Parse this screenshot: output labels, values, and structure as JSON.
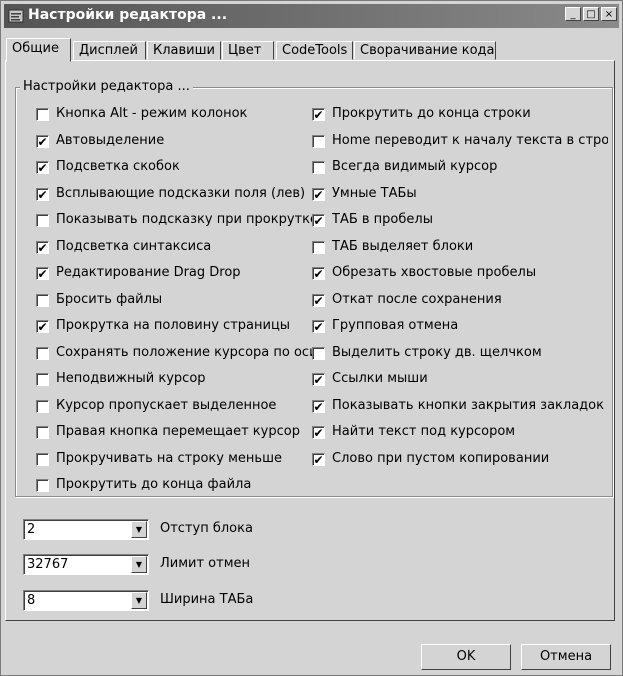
{
  "window": {
    "title": "Настройки редактора ...",
    "minimize": "_",
    "maximize": "□",
    "close": "×"
  },
  "tabs": [
    {
      "label": "Общие",
      "active": true
    },
    {
      "label": "Дисплей",
      "active": false
    },
    {
      "label": "Клавиши",
      "active": false
    },
    {
      "label": "Цвет",
      "active": false
    },
    {
      "label": "CodeTools",
      "active": false
    },
    {
      "label": "Сворачивание кода",
      "active": false
    }
  ],
  "group": {
    "title": "Настройки редактора ..."
  },
  "left_options": [
    {
      "label": "Кнопка Alt - режим колонок",
      "checked": false
    },
    {
      "label": "Автовыделение",
      "checked": true
    },
    {
      "label": "Подсветка скобок",
      "checked": true
    },
    {
      "label": "Всплывающие подсказки поля (лев)",
      "checked": true
    },
    {
      "label": "Показывать подсказку при прокрутке",
      "checked": false
    },
    {
      "label": "Подсветка синтаксиса",
      "checked": true
    },
    {
      "label": "Редактирование Drag Drop",
      "checked": true
    },
    {
      "label": "Бросить файлы",
      "checked": false
    },
    {
      "label": "Прокрутка на половину страницы",
      "checked": true
    },
    {
      "label": "Сохранять положение курсора по оси X",
      "checked": false
    },
    {
      "label": "Неподвижный курсор",
      "checked": false
    },
    {
      "label": "Курсор пропускает выделенное",
      "checked": false
    },
    {
      "label": "Правая кнопка перемещает курсор",
      "checked": false
    },
    {
      "label": "Прокручивать на строку меньше",
      "checked": false
    },
    {
      "label": "Прокрутить до конца файла",
      "checked": false
    }
  ],
  "right_options": [
    {
      "label": "Прокрутить до конца строки",
      "checked": true
    },
    {
      "label": "Home переводит к началу текста в строке",
      "checked": false
    },
    {
      "label": "Всегда видимый курсор",
      "checked": false
    },
    {
      "label": "Умные ТАБы",
      "checked": true
    },
    {
      "label": "ТАБ в пробелы",
      "checked": true
    },
    {
      "label": "ТАБ выделяет блоки",
      "checked": false
    },
    {
      "label": "Обрезать хвостовые пробелы",
      "checked": true
    },
    {
      "label": "Откат после сохранения",
      "checked": true
    },
    {
      "label": "Групповая отмена",
      "checked": true
    },
    {
      "label": "Выделить строку дв. щелчком",
      "checked": false
    },
    {
      "label": "Ссылки мыши",
      "checked": true
    },
    {
      "label": "Показывать кнопки закрытия закладок",
      "checked": true
    },
    {
      "label": "Найти текст под курсором",
      "checked": true
    },
    {
      "label": "Слово при пустом копировании",
      "checked": true
    }
  ],
  "fields": [
    {
      "value": "2",
      "label": "Отступ блока"
    },
    {
      "value": "32767",
      "label": "Лимит отмен"
    },
    {
      "value": "8",
      "label": "Ширина ТАБа"
    }
  ],
  "buttons": {
    "ok": "OK",
    "cancel": "Отмена"
  },
  "check_glyph": "✔",
  "dropdown_glyph": "▼"
}
